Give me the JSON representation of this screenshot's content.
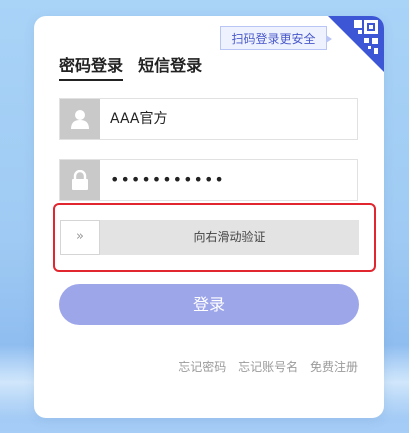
{
  "qr_tip": "扫码登录更安全",
  "tabs": [
    {
      "label": "密码登录"
    },
    {
      "label": "短信登录"
    }
  ],
  "username": {
    "value": "AAA官方"
  },
  "password": {
    "value": "•••••••••••"
  },
  "slider": {
    "handle": "»",
    "label": "向右滑动验证"
  },
  "login_button": "登录",
  "links": [
    {
      "label": "忘记密码"
    },
    {
      "label": "忘记账号名"
    },
    {
      "label": "免费注册"
    }
  ],
  "colors": {
    "accent": "#9ea6ea",
    "highlight": "#e2262f",
    "qr_blue": "#3c56d6"
  }
}
